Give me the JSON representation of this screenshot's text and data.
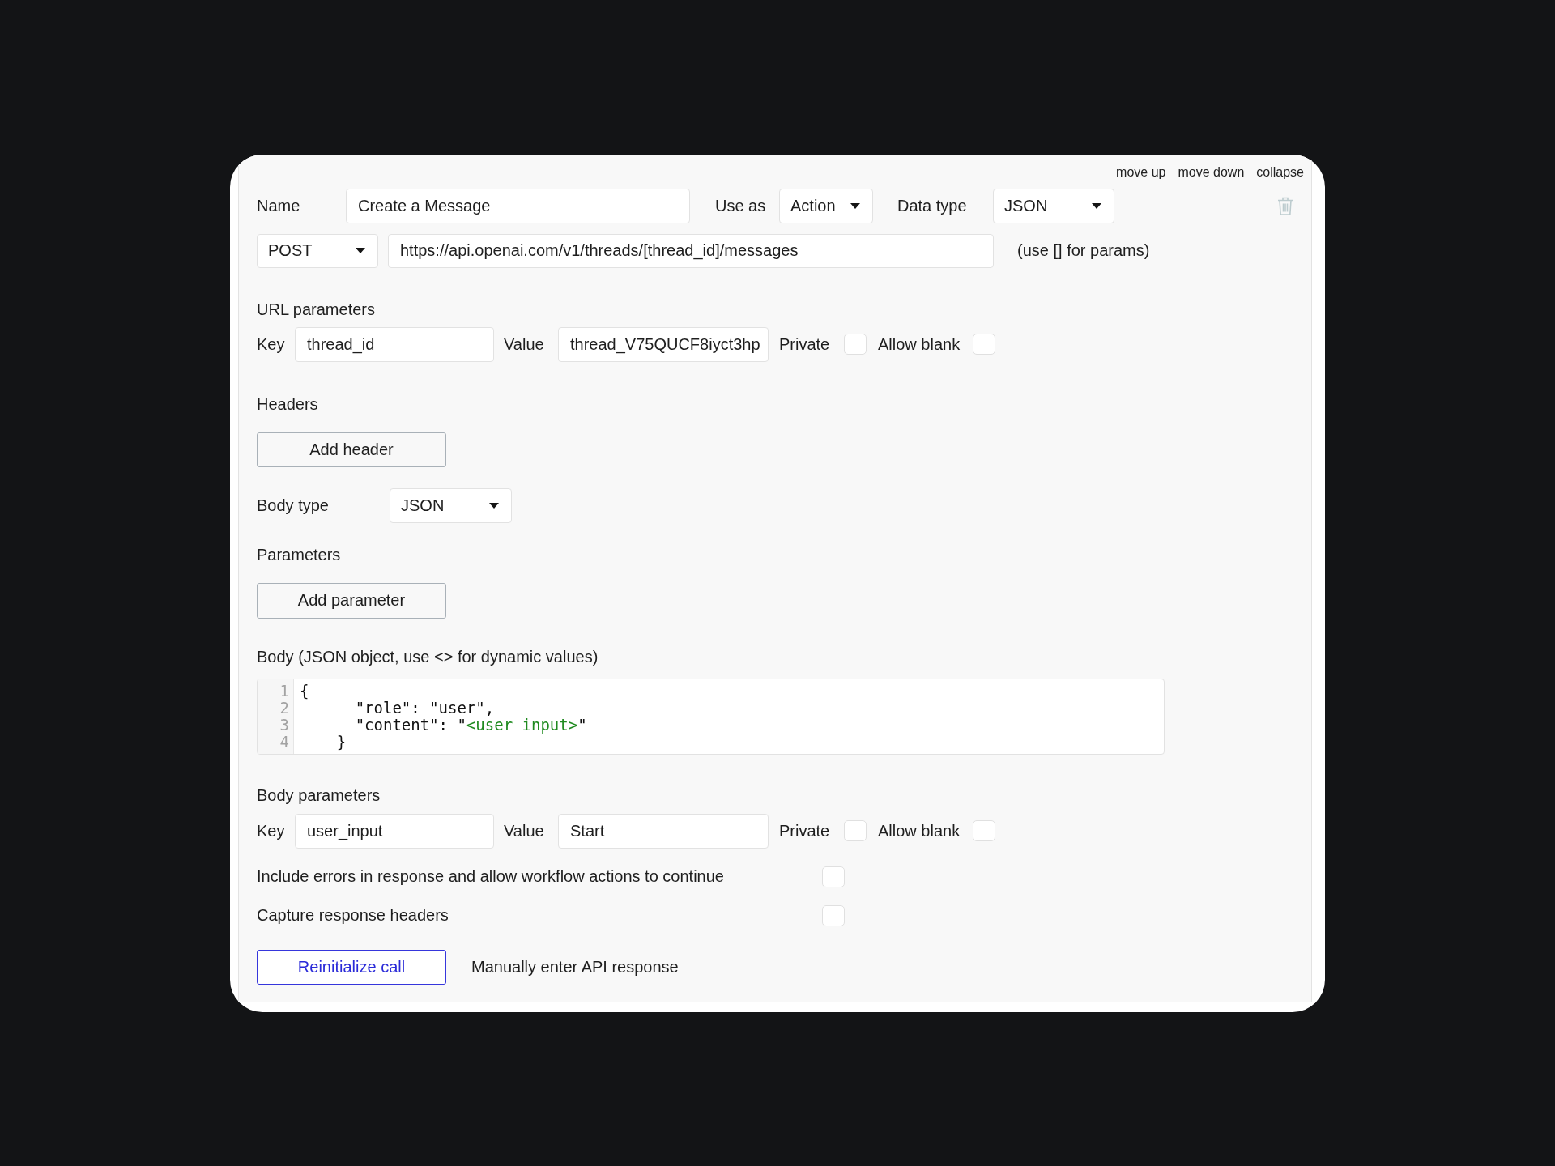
{
  "panel_actions": [
    {
      "label": "move up"
    },
    {
      "label": "move down"
    },
    {
      "label": "collapse"
    }
  ],
  "call": {
    "name_label": "Name",
    "name": "Create a Message",
    "use_as_label": "Use as",
    "use_as": "Action",
    "data_type_label": "Data type",
    "data_type": "JSON"
  },
  "request": {
    "method": "POST",
    "url": "https://api.openai.com/v1/threads/[thread_id]/messages",
    "hint": "(use [] for params)"
  },
  "url_parameters": {
    "title": "URL parameters",
    "rows": [
      {
        "key_label": "Key",
        "key": "thread_id",
        "value_label": "Value",
        "value": "thread_V75QUCF8iyct3hp",
        "private_label": "Private",
        "private": false,
        "allow_blank_label": "Allow blank",
        "allow_blank": false
      }
    ]
  },
  "headers": {
    "title": "Headers",
    "add_button": "Add header"
  },
  "body_type": {
    "label": "Body type",
    "value": "JSON"
  },
  "parameters": {
    "title": "Parameters",
    "add_button": "Add parameter"
  },
  "body": {
    "title": "Body (JSON object, use <> for dynamic values)",
    "lines": [
      {
        "number": "1",
        "parts": [
          {
            "kind": "plain",
            "text": "{"
          }
        ]
      },
      {
        "number": "2",
        "parts": [
          {
            "kind": "plain",
            "text": "      \"role\": \"user\","
          }
        ]
      },
      {
        "number": "3",
        "parts": [
          {
            "kind": "plain",
            "text": "      \"content\": \""
          },
          {
            "kind": "dynamic",
            "text": "<user_input>"
          },
          {
            "kind": "plain",
            "text": "\""
          }
        ]
      },
      {
        "number": "4",
        "parts": [
          {
            "kind": "plain",
            "text": "    }"
          }
        ]
      }
    ]
  },
  "body_parameters": {
    "title": "Body parameters",
    "rows": [
      {
        "key_label": "Key",
        "key": "user_input",
        "value_label": "Value",
        "value": "Start",
        "private_label": "Private",
        "private": false,
        "allow_blank_label": "Allow blank",
        "allow_blank": false
      }
    ]
  },
  "options": [
    {
      "label": "Include errors in response and allow workflow actions to continue",
      "checked": false
    },
    {
      "label": "Capture response headers",
      "checked": false
    }
  ],
  "actions": {
    "reinitialize_button": "Reinitialize call",
    "manual_link": "Manually enter API response"
  }
}
